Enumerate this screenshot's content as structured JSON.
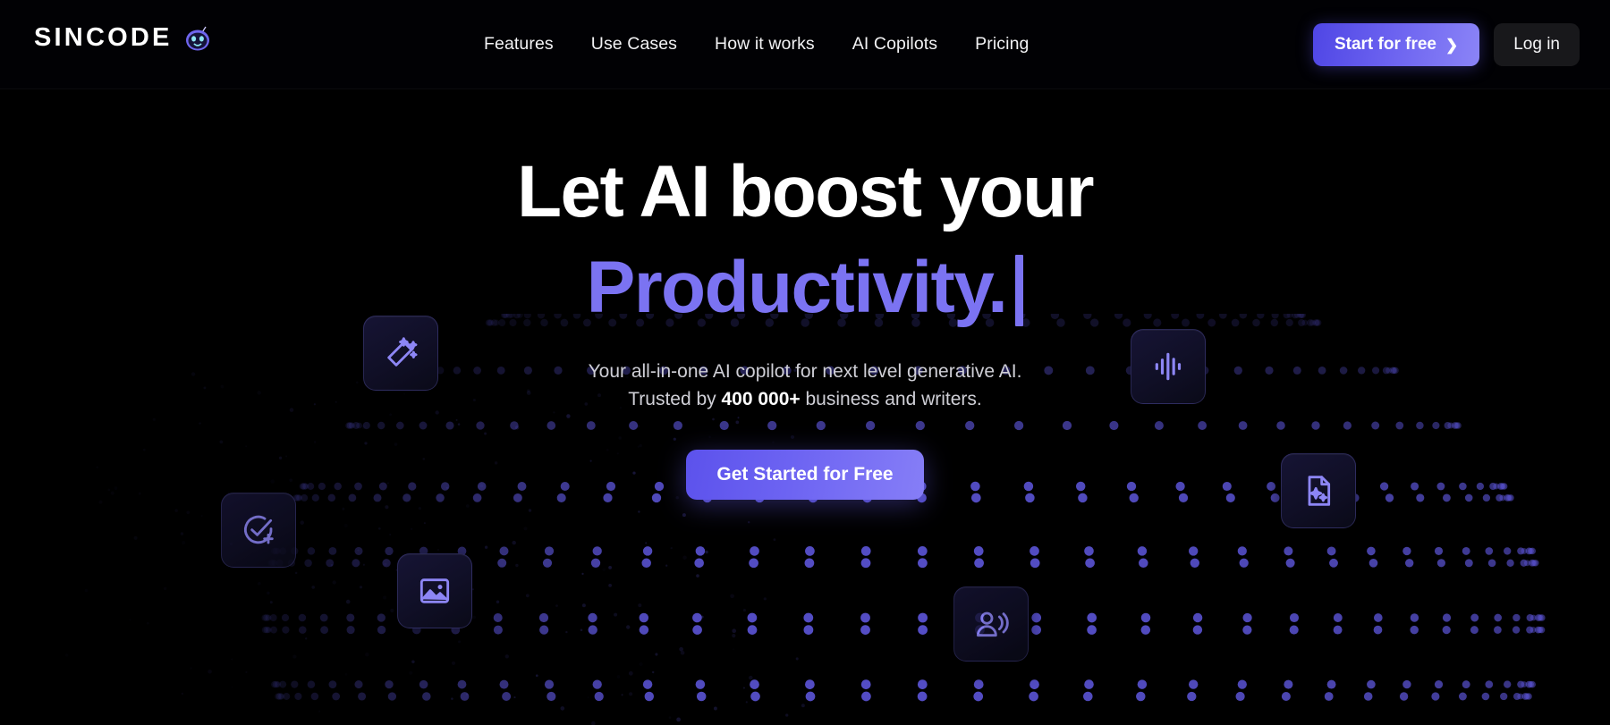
{
  "brand": {
    "name": "SINCODE",
    "logo_icon": "robot-mascot-icon",
    "accent_color": "#7b73f2"
  },
  "header": {
    "nav": [
      {
        "label": "Features",
        "name": "features"
      },
      {
        "label": "Use Cases",
        "name": "use-cases"
      },
      {
        "label": "How it works",
        "name": "how-it-works"
      },
      {
        "label": "AI Copilots",
        "name": "ai-copilots"
      },
      {
        "label": "Pricing",
        "name": "pricing"
      }
    ],
    "start_button": {
      "label": "Start for free",
      "icon": "chevron-right-icon"
    },
    "login_button": {
      "label": "Log in"
    }
  },
  "hero": {
    "headline_line1": "Let AI boost your",
    "headline_line2": "Productivity.",
    "caret_visible": true,
    "subtitle_line1": "Your all-in-one AI copilot for next level generative AI.",
    "subtitle_line2_pre": "Trusted by ",
    "subtitle_line2_strong": "400 000+",
    "subtitle_line2_post": " business and writers.",
    "cta_label": "Get Started for Free"
  },
  "floating_cards": [
    {
      "name": "magic-wand-card",
      "icon": "magic-wand-icon"
    },
    {
      "name": "check-circle-plus-card",
      "icon": "check-circle-plus-icon"
    },
    {
      "name": "image-card",
      "icon": "image-icon"
    },
    {
      "name": "audio-waveform-card",
      "icon": "audio-waveform-icon"
    },
    {
      "name": "document-sparkle-card",
      "icon": "document-sparkle-icon"
    },
    {
      "name": "voice-person-card",
      "icon": "person-speaking-icon"
    }
  ],
  "background": {
    "decoration": "dotted-sphere-grid",
    "dot_color": "#5b54d6"
  }
}
